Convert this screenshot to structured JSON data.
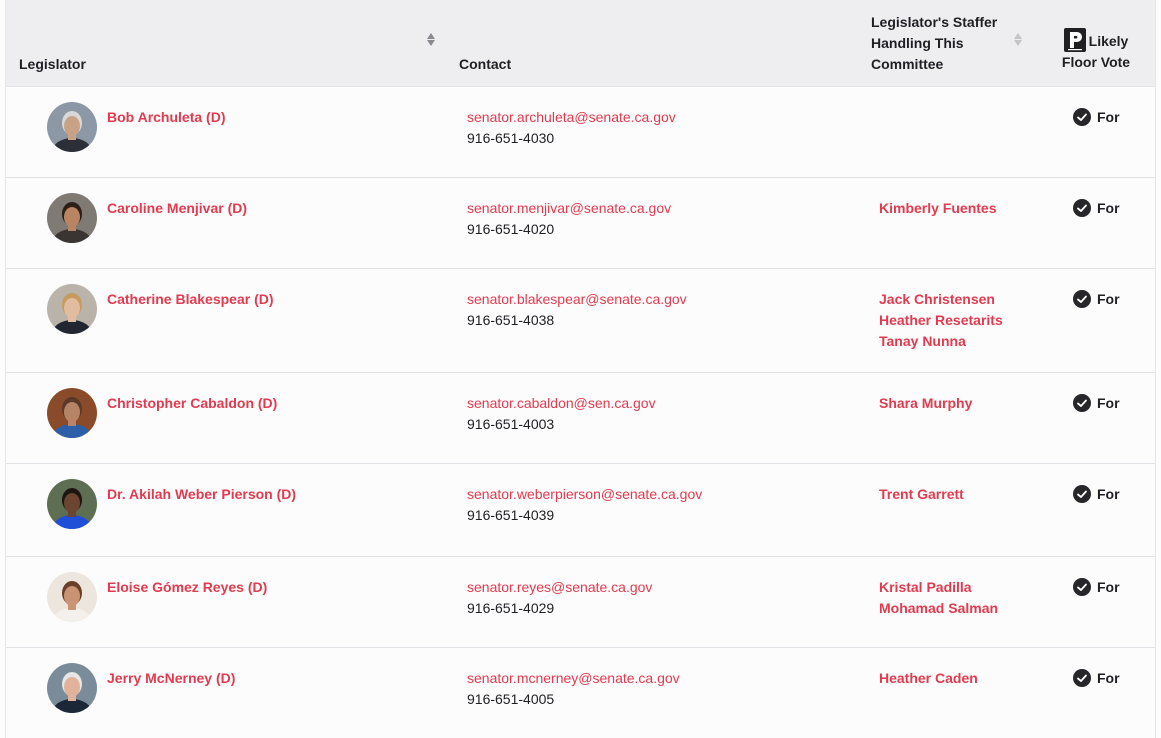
{
  "header": {
    "legislator": "Legislator",
    "contact": "Contact",
    "staffer": "Legislator's Staffer Handling This Committee",
    "vote": "Likely Floor Vote",
    "vote_icon": "p-logo-icon"
  },
  "rows": [
    {
      "name": "Bob Archuleta (D)",
      "email": "senator.archuleta@senate.ca.gov",
      "phone": "916-651-4030",
      "staffers": [],
      "vote": "For",
      "avatar": {
        "bg": "#8d98a6",
        "skin": "#c9a286",
        "hair": "#d8d8d8",
        "shirt": "#2c2f38"
      }
    },
    {
      "name": "Caroline Menjivar (D)",
      "email": "senator.menjivar@senate.ca.gov",
      "phone": "916-651-4020",
      "staffers": [
        "Kimberly Fuentes"
      ],
      "vote": "For",
      "avatar": {
        "bg": "#7f7a74",
        "skin": "#b98462",
        "hair": "#2b1f18",
        "shirt": "#3a3532"
      }
    },
    {
      "name": "Catherine Blakespear (D)",
      "email": "senator.blakespear@senate.ca.gov",
      "phone": "916-651-4038",
      "staffers": [
        "Jack Christensen",
        "Heather Resetarits",
        "Tanay Nunna"
      ],
      "vote": "For",
      "avatar": {
        "bg": "#b9b3aa",
        "skin": "#e2bca1",
        "hair": "#c79a5e",
        "shirt": "#222631"
      }
    },
    {
      "name": "Christopher Cabaldon (D)",
      "email": "senator.cabaldon@sen.ca.gov",
      "phone": "916-651-4003",
      "staffers": [
        "Shara Murphy"
      ],
      "vote": "For",
      "avatar": {
        "bg": "#8a4b2a",
        "skin": "#b88468",
        "hair": "#5a3a2a",
        "shirt": "#2c5fa8"
      }
    },
    {
      "name": "Dr. Akilah Weber Pierson (D)",
      "email": "senator.weberpierson@senate.ca.gov",
      "phone": "916-651-4039",
      "staffers": [
        "Trent Garrett"
      ],
      "vote": "For",
      "avatar": {
        "bg": "#5e6e52",
        "skin": "#6b4532",
        "hair": "#1d1512",
        "shirt": "#1f4fd6"
      }
    },
    {
      "name": "Eloise Gómez Reyes (D)",
      "email": "senator.reyes@senate.ca.gov",
      "phone": "916-651-4029",
      "staffers": [
        "Kristal Padilla",
        "Mohamad Salman"
      ],
      "vote": "For",
      "avatar": {
        "bg": "#ece6df",
        "skin": "#c99473",
        "hair": "#6a3f28",
        "shirt": "#f3efea"
      }
    },
    {
      "name": "Jerry McNerney (D)",
      "email": "senator.mcnerney@senate.ca.gov",
      "phone": "916-651-4005",
      "staffers": [
        "Heather Caden"
      ],
      "vote": "For",
      "avatar": {
        "bg": "#7a8c99",
        "skin": "#e0b29a",
        "hair": "#e6e6e6",
        "shirt": "#1c2738"
      }
    }
  ]
}
